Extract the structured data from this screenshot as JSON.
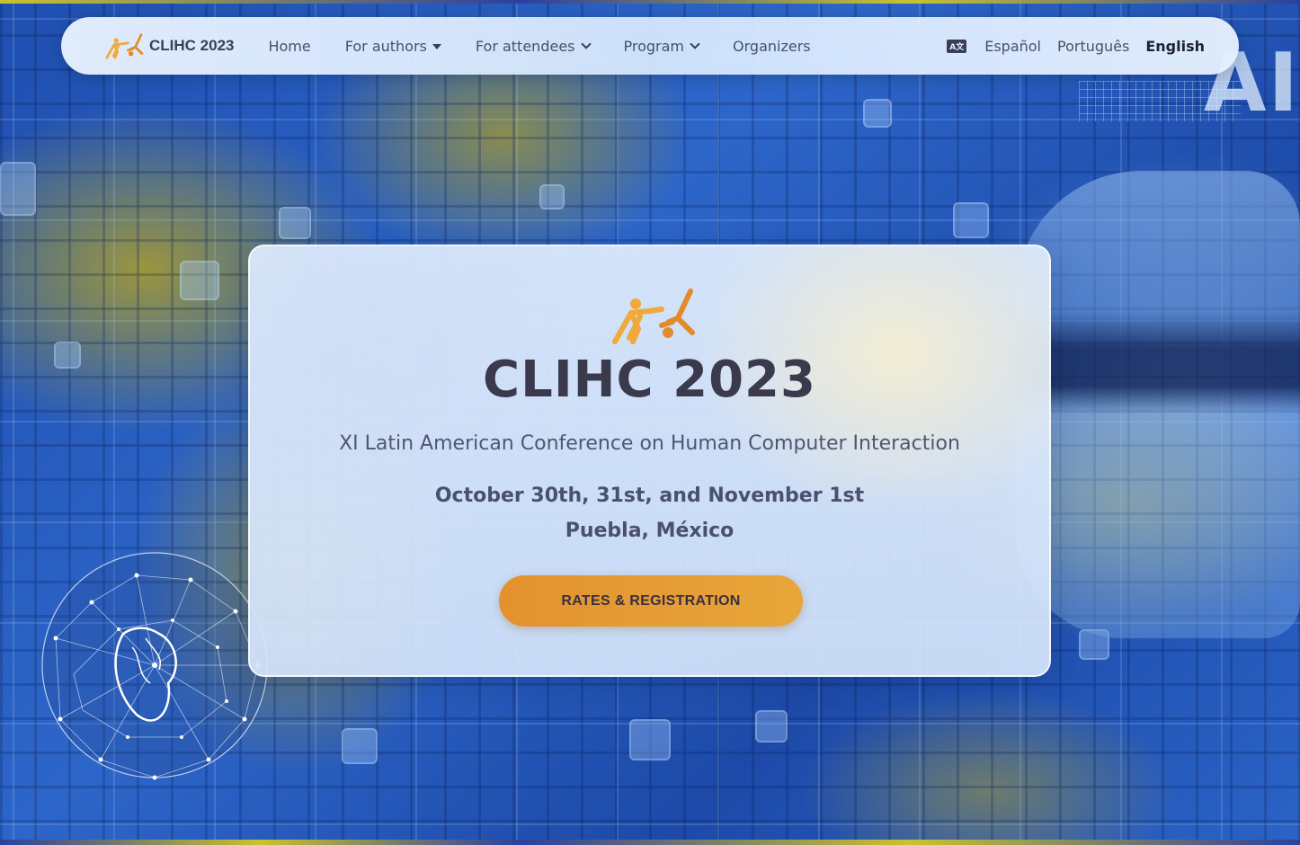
{
  "navbar": {
    "brand_name": "CLIHC 2023",
    "links": [
      {
        "label": "Home"
      },
      {
        "label": "For authors"
      },
      {
        "label": "For attendees"
      },
      {
        "label": "Program"
      },
      {
        "label": "Organizers"
      }
    ],
    "languages": [
      {
        "label": "Español",
        "active": false
      },
      {
        "label": "Português",
        "active": false
      },
      {
        "label": "English",
        "active": true
      }
    ],
    "translate_icon_text": "A文"
  },
  "hero": {
    "title": "CLIHC 2023",
    "subtitle": "XI Latin American Conference on Human Computer Interaction",
    "dates": "October 30th, 31st, and November 1st",
    "location": "Puebla, México",
    "cta_label": "RATES & REGISTRATION"
  },
  "background": {
    "ai_text": "AI"
  },
  "colors": {
    "accent_orange": "#e8a63a",
    "title_text": "#3a3a4c",
    "background_blue": "#2a5cb8",
    "background_olive": "#b0a028"
  },
  "icons": {
    "logo": "people-falling-logo",
    "translate": "translate-icon",
    "dropdown_solid": "caret-down-icon",
    "dropdown_chevron": "chevron-down-icon"
  }
}
